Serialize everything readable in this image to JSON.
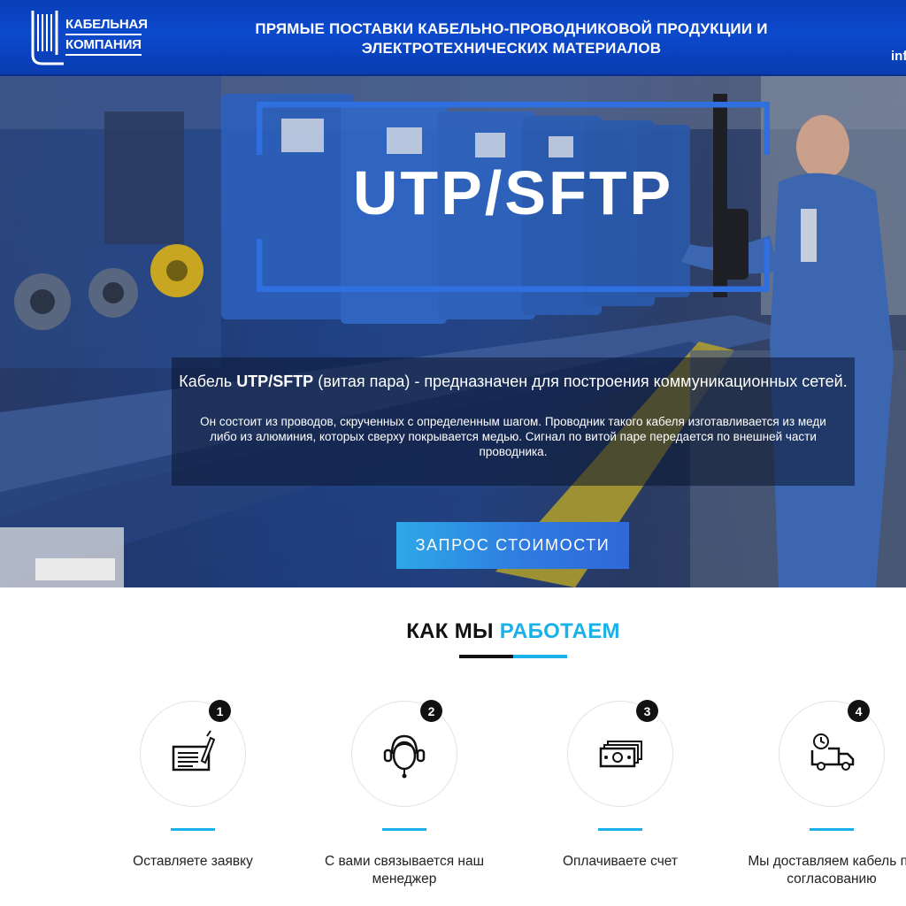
{
  "header": {
    "logo_line1": "КАБЕЛЬНАЯ",
    "logo_line2": "КОМПАНИЯ",
    "title": "ПРЯМЫЕ ПОСТАВКИ КАБЕЛЬНО-ПРОВОДНИКОВОЙ ПРОДУКЦИИ И ЭЛЕКТРОТЕХНИЧЕСКИХ МАТЕРИАЛОВ",
    "email_partial": "inf"
  },
  "hero": {
    "title": "UTP/SFTP",
    "lead_prefix": "Кабель ",
    "lead_bold": "UTP/SFTP",
    "lead_suffix": " (витая пара) -  предназначен для построения коммуникационных сетей.",
    "description": "Он состоит из проводов, скрученных с определенным шагом. Проводник такого кабеля изготавливается из меди либо из алюминия, которых сверху покрывается медью. Сигнал по витой паре передается по внешней части проводника.",
    "cta_label": "ЗАПРОС СТОИМОСТИ"
  },
  "how_we_work": {
    "title_dark": "КАК МЫ ",
    "title_accent": "РАБОТАЕМ",
    "steps": [
      {
        "number": "1",
        "icon": "form-icon",
        "label": "Оставляете заявку"
      },
      {
        "number": "2",
        "icon": "manager-headset-icon",
        "label": "С вами связывается наш менеджер"
      },
      {
        "number": "3",
        "icon": "money-icon",
        "label": "Оплачиваете счет"
      },
      {
        "number": "4",
        "icon": "delivery-truck-icon",
        "label": "Мы доставляем кабель по согласованию"
      }
    ]
  },
  "colors": {
    "header_blue": "#0b49cc",
    "accent_cyan": "#1ab0ea",
    "frame_blue": "#2f6fe0"
  }
}
